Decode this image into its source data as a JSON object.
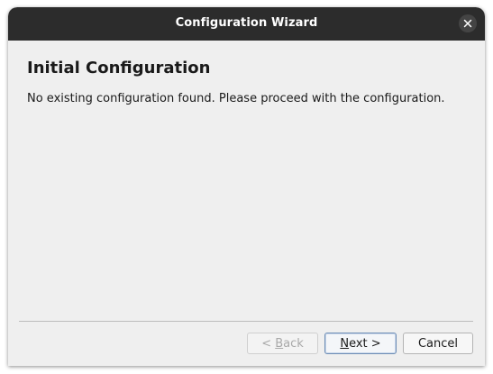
{
  "window": {
    "title": "Configuration Wizard",
    "close_icon": "close-icon"
  },
  "content": {
    "heading": "Initial Configuration",
    "message": "No existing configuration found. Please proceed with the configuration."
  },
  "buttons": {
    "back": {
      "prefix": "< ",
      "mnemonic": "B",
      "rest": "ack",
      "enabled": false
    },
    "next": {
      "mnemonic": "N",
      "rest": "ext >",
      "enabled": true,
      "focused": true
    },
    "cancel": {
      "label": "Cancel",
      "enabled": true
    }
  },
  "colors": {
    "titlebar": "#2c2c2c",
    "background": "#efefef",
    "focus_border": "#6d8db5"
  }
}
